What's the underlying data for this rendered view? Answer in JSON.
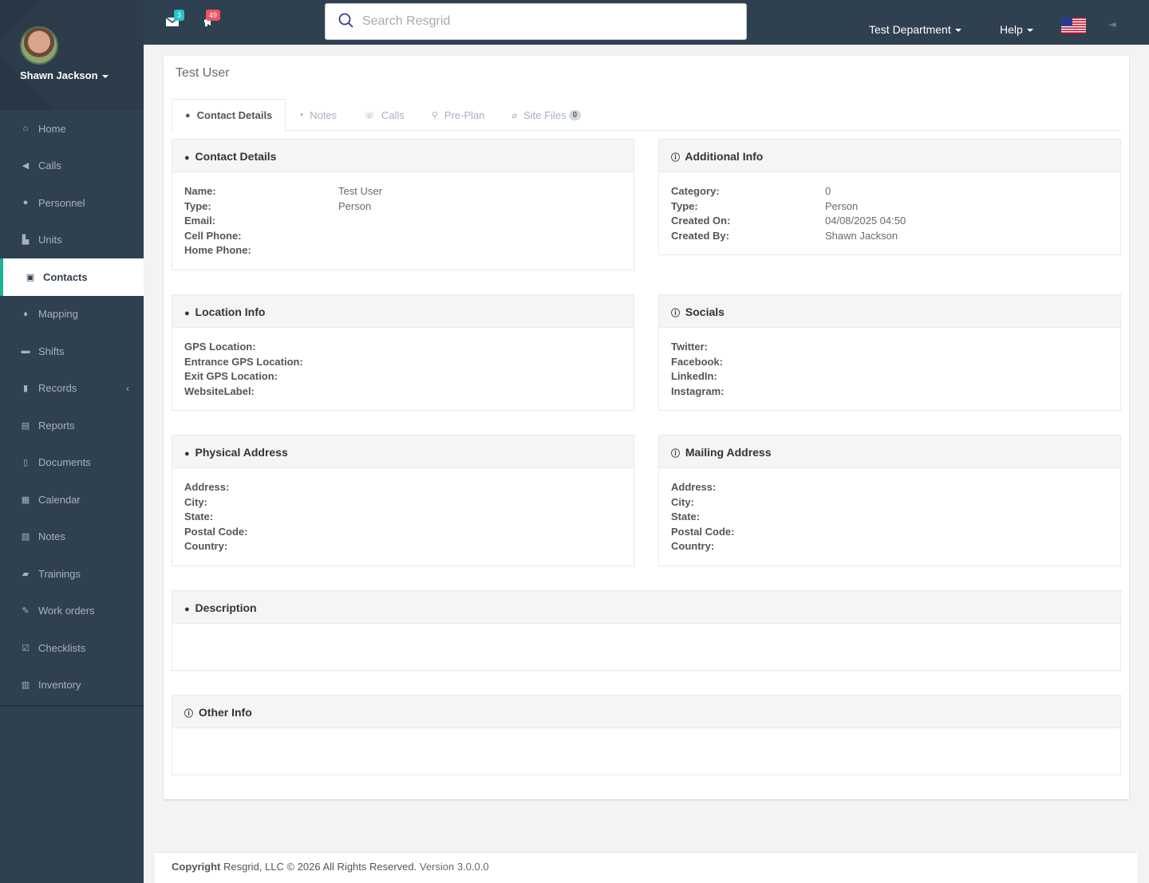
{
  "user": {
    "name": "Shawn Jackson"
  },
  "nav": [
    {
      "label": "Home",
      "icon": "home-icon",
      "glyph": "⌂"
    },
    {
      "label": "Calls",
      "icon": "bullhorn-icon",
      "glyph": "◀"
    },
    {
      "label": "Personnel",
      "icon": "user-icon",
      "glyph": "●"
    },
    {
      "label": "Units",
      "icon": "truck-icon",
      "glyph": "▙"
    },
    {
      "label": "Contacts",
      "icon": "contact-book-icon",
      "glyph": "▣"
    },
    {
      "label": "Mapping",
      "icon": "map-marker-icon",
      "glyph": "♦"
    },
    {
      "label": "Shifts",
      "icon": "briefcase-icon",
      "glyph": "▬"
    },
    {
      "label": "Records",
      "icon": "file-icon",
      "glyph": "▮"
    },
    {
      "label": "Reports",
      "icon": "clipboard-icon",
      "glyph": "▤"
    },
    {
      "label": "Documents",
      "icon": "document-icon",
      "glyph": "▯"
    },
    {
      "label": "Calendar",
      "icon": "calendar-icon",
      "glyph": "▦"
    },
    {
      "label": "Notes",
      "icon": "notes-icon",
      "glyph": "▧"
    },
    {
      "label": "Trainings",
      "icon": "book-icon",
      "glyph": "▰"
    },
    {
      "label": "Work orders",
      "icon": "wrench-icon",
      "glyph": "✎"
    },
    {
      "label": "Checklists",
      "icon": "checkbox-icon",
      "glyph": "☑"
    },
    {
      "label": "Inventory",
      "icon": "barcode-icon",
      "glyph": "▥"
    }
  ],
  "topbar": {
    "messages_count": "3",
    "calls_count": "49",
    "search_placeholder": "Search Resgrid",
    "department": "Test Department",
    "help": "Help"
  },
  "page": {
    "title": "Test User",
    "tabs": [
      {
        "label": "Contact Details",
        "icon": "user-icon",
        "glyph": "●"
      },
      {
        "label": "Notes",
        "icon": "note-icon",
        "glyph": "▪"
      },
      {
        "label": "Calls",
        "icon": "phone-icon",
        "glyph": "☏"
      },
      {
        "label": "Pre-Plan",
        "icon": "fire-extinguisher-icon",
        "glyph": "⚲"
      },
      {
        "label": "Site Files",
        "icon": "paperclip-icon",
        "glyph": "⌀",
        "count": "0"
      }
    ]
  },
  "contact_details": {
    "title": "Contact Details",
    "rows": [
      {
        "label": "Name:",
        "value": "Test User"
      },
      {
        "label": "Type:",
        "value": "Person"
      },
      {
        "label": "Email:",
        "value": ""
      },
      {
        "label": "Cell Phone:",
        "value": ""
      },
      {
        "label": "Home Phone:",
        "value": ""
      }
    ]
  },
  "additional_info": {
    "title": "Additional Info",
    "rows": [
      {
        "label": "Category:",
        "value": "0"
      },
      {
        "label": "Type:",
        "value": "Person"
      },
      {
        "label": "Created On:",
        "value": "04/08/2025 04:50"
      },
      {
        "label": "Created By:",
        "value": "Shawn Jackson"
      }
    ]
  },
  "location_info": {
    "title": "Location Info",
    "rows": [
      {
        "label": "GPS Location:",
        "value": ""
      },
      {
        "label": "Entrance GPS Location:",
        "value": ""
      },
      {
        "label": "Exit GPS Location:",
        "value": ""
      },
      {
        "label": "WebsiteLabel:",
        "value": ""
      }
    ]
  },
  "socials": {
    "title": "Socials",
    "rows": [
      {
        "label": "Twitter:",
        "value": ""
      },
      {
        "label": "Facebook:",
        "value": ""
      },
      {
        "label": "LinkedIn:",
        "value": ""
      },
      {
        "label": "Instagram:",
        "value": ""
      }
    ]
  },
  "physical_address": {
    "title": "Physical Address",
    "rows": [
      {
        "label": "Address:",
        "value": ""
      },
      {
        "label": "City:",
        "value": ""
      },
      {
        "label": "State:",
        "value": ""
      },
      {
        "label": "Postal Code:",
        "value": ""
      },
      {
        "label": "Country:",
        "value": ""
      }
    ]
  },
  "mailing_address": {
    "title": "Mailing Address",
    "rows": [
      {
        "label": "Address:",
        "value": ""
      },
      {
        "label": "City:",
        "value": ""
      },
      {
        "label": "State:",
        "value": ""
      },
      {
        "label": "Postal Code:",
        "value": ""
      },
      {
        "label": "Country:",
        "value": ""
      }
    ]
  },
  "description": {
    "title": "Description"
  },
  "other_info": {
    "title": "Other Info"
  },
  "footer": {
    "copyright": "Copyright",
    "text": " Resgrid, LLC © 2026 All Rights Reserved.",
    "version": " Version 3.0.0.0"
  },
  "colors": {
    "sidebar": "#2f4050",
    "accent": "#1ab394",
    "badge_blue": "#23c6c8",
    "badge_red": "#ed5565"
  }
}
